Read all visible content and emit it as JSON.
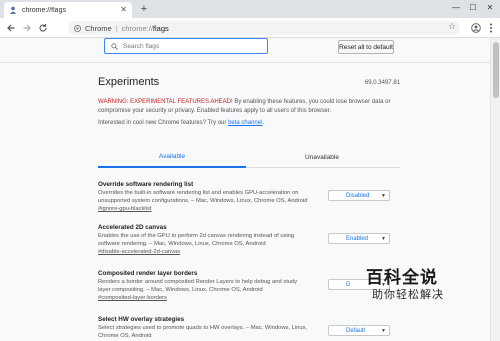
{
  "browser": {
    "tab_title": "chrome://flags",
    "new_tab": "+",
    "window_controls": {
      "minimize": "—",
      "maximize": "☐",
      "close": "✕"
    },
    "omnibox": {
      "origin_label": "Chrome",
      "separator": "|",
      "scheme": "chrome://",
      "path": "flags"
    }
  },
  "header": {
    "search_placeholder": "Search flags",
    "reset_button": "Reset all to default"
  },
  "main": {
    "title": "Experiments",
    "version": "69.0.3497.81",
    "warning_label": "WARNING: EXPERIMENTAL FEATURES AHEAD!",
    "warning_text": " By enabling these features, you could lose browser data or compromise your security or privacy. Enabled features apply to all users of this browser.",
    "interest_text": "Interested in cool new Chrome features? Try our ",
    "interest_link": "beta channel",
    "interest_end": ".",
    "tabs": [
      {
        "label": "Available",
        "active": true
      },
      {
        "label": "Unavailable",
        "active": false
      }
    ],
    "experiments": [
      {
        "name": "Override software rendering list",
        "description": "Overrides the built-in software rendering list and enables GPU-acceleration on unsupported system configurations. – Mac, Windows, Linux, Chrome OS, Android",
        "link": "#ignore-gpu-blacklist",
        "value": "Disabled"
      },
      {
        "name": "Accelerated 2D canvas",
        "description": "Enables the use of the GPU to perform 2d canvas rendering instead of using software rendering. – Mac, Windows, Linux, Chrome OS, Android",
        "link": "#disable-accelerated-2d-canvas",
        "value": "Enabled"
      },
      {
        "name": "Composited render layer borders",
        "description": "Renders a border around composited Render Layers to help debug and study layer compositing. – Mac, Windows, Linux, Chrome OS, Android",
        "link": "#composited-layer-borders",
        "value": "D"
      },
      {
        "name": "Select HW overlay strategies",
        "description": "Select strategies used to promote quads to HW overlays. – Mac, Windows, Linux, Chrome OS, Android",
        "link": "",
        "value": "Default"
      }
    ]
  },
  "watermark": {
    "line1": "百科全说",
    "line2": "助你轻松解决"
  },
  "colors": {
    "accent": "#1a73e8",
    "warning": "#c5221f",
    "search_border": "#4285f4"
  }
}
